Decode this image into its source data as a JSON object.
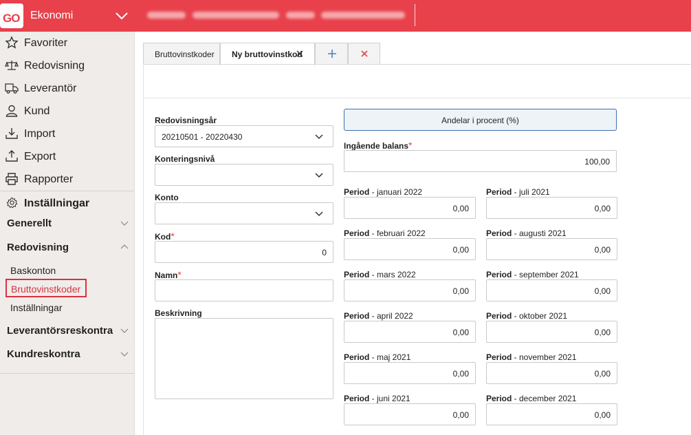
{
  "header": {
    "logo_text": "GO",
    "app_name": "Ekonomi",
    "chevron_icon": "chevron-down-icon",
    "brand_color": "#e8414b"
  },
  "sidebar": {
    "nav": [
      {
        "label": "Favoriter",
        "icon": "star-icon"
      },
      {
        "label": "Redovisning",
        "icon": "scale-icon"
      },
      {
        "label": "Leverantör",
        "icon": "truck-icon"
      },
      {
        "label": "Kund",
        "icon": "person-icon"
      },
      {
        "label": "Import",
        "icon": "import-icon"
      },
      {
        "label": "Export",
        "icon": "export-icon"
      },
      {
        "label": "Rapporter",
        "icon": "printer-icon"
      }
    ],
    "settings": {
      "label": "Inställningar",
      "icon": "gear-icon"
    },
    "groups": {
      "generellt": "Generellt",
      "redovisning": "Redovisning",
      "leverantorsreskontra": "Leverantörsreskontra",
      "kundreskontra": "Kundreskontra"
    },
    "sub_items": {
      "baskonton": "Baskonton",
      "bruttovinstkoder": "Bruttovinstkoder",
      "installningar": "Inställningar"
    }
  },
  "tabs": {
    "list_tab": "Bruttovinstkoder",
    "active_tab": "Ny bruttovinstkod",
    "close_icon": "close-icon",
    "add_icon": "plus-icon",
    "remove_icon": "close-red-icon"
  },
  "form": {
    "redovisningsar": {
      "label": "Redovisningsår",
      "value": "20210501 - 20220430"
    },
    "konteringsniva": {
      "label": "Konteringsnivå",
      "value": ""
    },
    "konto": {
      "label": "Konto",
      "value": ""
    },
    "kod": {
      "label": "Kod",
      "required": "*",
      "value": "0"
    },
    "namn": {
      "label": "Namn",
      "required": "*",
      "value": ""
    },
    "beskrivning": {
      "label": "Beskrivning",
      "value": ""
    }
  },
  "right": {
    "percent_button": "Andelar i procent (%)",
    "ingaende_balans": {
      "label": "Ingående balans",
      "required": "*",
      "value": "100,00"
    },
    "period_word": "Period",
    "periods_left": [
      {
        "month": " - januari 2022",
        "value": "0,00"
      },
      {
        "month": " - februari 2022",
        "value": "0,00"
      },
      {
        "month": " - mars 2022",
        "value": "0,00"
      },
      {
        "month": " - april 2022",
        "value": "0,00"
      },
      {
        "month": " - maj 2021",
        "value": "0,00"
      },
      {
        "month": " - juni 2021",
        "value": "0,00"
      }
    ],
    "periods_right": [
      {
        "month": " - juli 2021",
        "value": "0,00"
      },
      {
        "month": " - augusti 2021",
        "value": "0,00"
      },
      {
        "month": " - september 2021",
        "value": "0,00"
      },
      {
        "month": " - oktober 2021",
        "value": "0,00"
      },
      {
        "month": " - november 2021",
        "value": "0,00"
      },
      {
        "month": " - december 2021",
        "value": "0,00"
      }
    ]
  }
}
